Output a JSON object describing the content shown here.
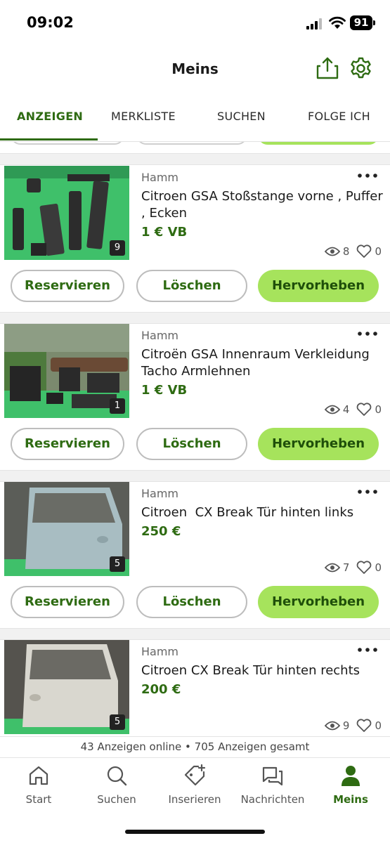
{
  "status_bar": {
    "time": "09:02",
    "battery": "91"
  },
  "header": {
    "title": "Meins",
    "share_icon": "share-icon",
    "settings_icon": "gear-icon"
  },
  "tabs": [
    {
      "label": "ANZEIGEN",
      "active": true
    },
    {
      "label": "MERKLISTE",
      "active": false
    },
    {
      "label": "SUCHEN",
      "active": false
    },
    {
      "label": "FOLGE ICH",
      "active": false
    }
  ],
  "listings": [
    {
      "location": "Hamm",
      "title": "Citroen GSA Stoßstange vorne , Puffer , Ecken",
      "price": "1 € VB",
      "image_count": "9",
      "views": "8",
      "likes": "0",
      "buttons": {
        "reserve": "Reservieren",
        "delete": "Löschen",
        "highlight": "Hervorheben"
      }
    },
    {
      "location": "Hamm",
      "title": "Citroën GSA Innenraum Verkleidung Tacho Armlehnen",
      "price": "1 € VB",
      "image_count": "1",
      "views": "4",
      "likes": "0",
      "buttons": {
        "reserve": "Reservieren",
        "delete": "Löschen",
        "highlight": "Hervorheben"
      }
    },
    {
      "location": "Hamm",
      "title": "Citroen  CX Break Tür hinten links",
      "price": "250 €",
      "image_count": "5",
      "views": "7",
      "likes": "0",
      "buttons": {
        "reserve": "Reservieren",
        "delete": "Löschen",
        "highlight": "Hervorheben"
      }
    },
    {
      "location": "Hamm",
      "title": "Citroen CX Break Tür hinten rechts",
      "price": "200 €",
      "image_count": "5",
      "views": "9",
      "likes": "0"
    }
  ],
  "summary": "43 Anzeigen online • 705 Anzeigen gesamt",
  "bottom_nav": [
    {
      "label": "Start",
      "icon": "home-icon",
      "active": false
    },
    {
      "label": "Suchen",
      "icon": "search-icon",
      "active": false
    },
    {
      "label": "Inserieren",
      "icon": "add-tag-icon",
      "active": false
    },
    {
      "label": "Nachrichten",
      "icon": "messages-icon",
      "active": false
    },
    {
      "label": "Meins",
      "icon": "profile-icon",
      "active": true
    }
  ],
  "colors": {
    "accent": "#2e6b12",
    "highlight_button": "#a6e35c"
  }
}
